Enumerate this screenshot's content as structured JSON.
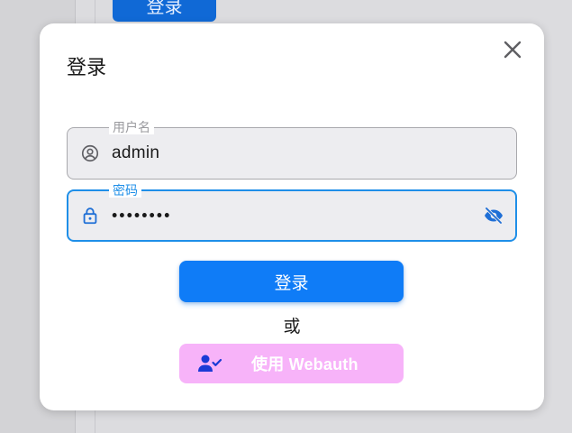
{
  "background": {
    "primary_button_label": "登录"
  },
  "dialog": {
    "title": "登录",
    "close_icon": "close-icon",
    "username": {
      "legend": "用户名",
      "value": "admin",
      "icon": "user-circle-icon"
    },
    "password": {
      "legend": "密码",
      "value": "••••••••",
      "icon": "lock-icon",
      "toggle_icon": "eye-off-icon"
    },
    "login_button_label": "登录",
    "or_text": "或",
    "webauth": {
      "label": "使用 Webauth",
      "icon": "user-check-icon"
    }
  },
  "colors": {
    "primary": "#0f7cf7",
    "focus_border": "#1f8fe8",
    "webauth_bg": "#f7b3f9",
    "webauth_icon": "#1a3ad6"
  }
}
